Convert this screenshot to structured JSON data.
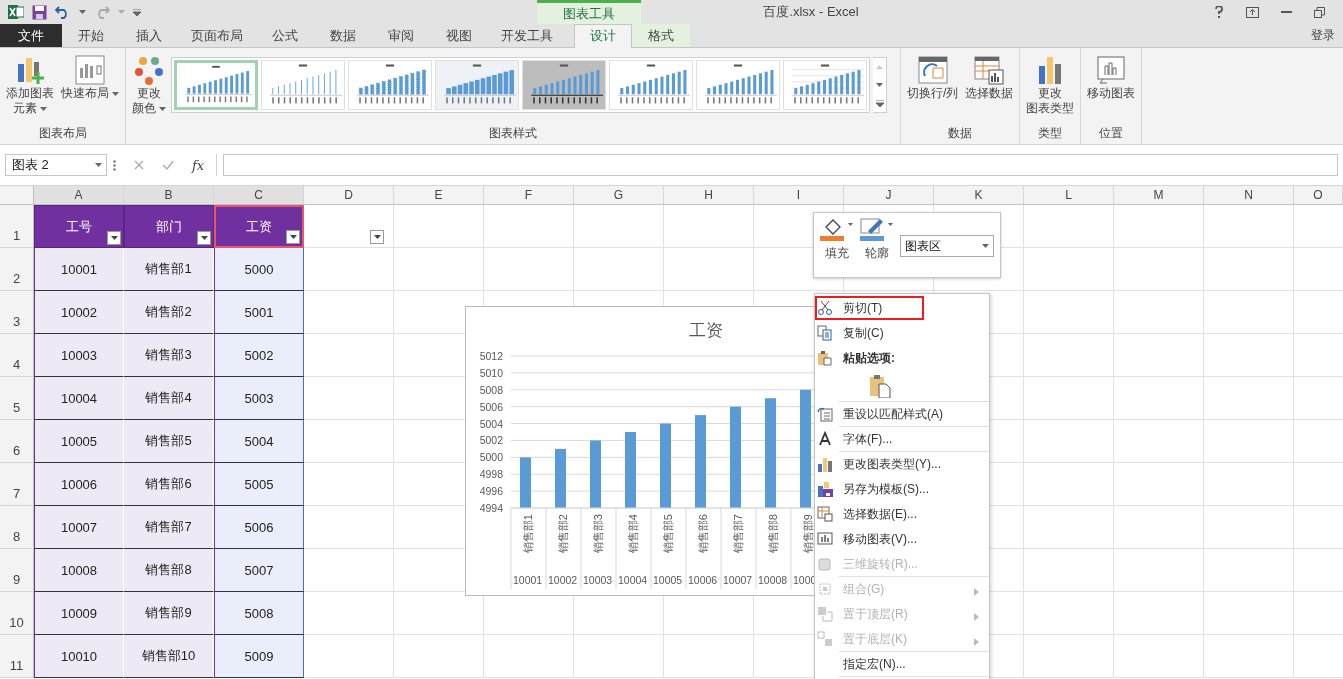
{
  "window": {
    "title": "百度.xlsx - Excel",
    "context_group": "图表工具",
    "sign_in": "登录"
  },
  "tabs": [
    {
      "label": "文件",
      "kind": "file",
      "selected": false
    },
    {
      "label": "开始",
      "kind": "normal",
      "selected": false
    },
    {
      "label": "插入",
      "kind": "normal",
      "selected": false
    },
    {
      "label": "页面布局",
      "kind": "normal",
      "selected": false
    },
    {
      "label": "公式",
      "kind": "normal",
      "selected": false
    },
    {
      "label": "数据",
      "kind": "normal",
      "selected": false
    },
    {
      "label": "审阅",
      "kind": "normal",
      "selected": false
    },
    {
      "label": "视图",
      "kind": "normal",
      "selected": false
    },
    {
      "label": "开发工具",
      "kind": "normal",
      "selected": false
    },
    {
      "label": "设计",
      "kind": "context",
      "selected": true
    },
    {
      "label": "格式",
      "kind": "context",
      "selected": false
    }
  ],
  "ribbon": {
    "groups": [
      {
        "title": "图表布局",
        "buttons": [
          {
            "lines": [
              "添加图表",
              "元素"
            ],
            "kind": "add-element",
            "dropdown": true
          },
          {
            "lines": [
              "快速布局"
            ],
            "kind": "quick-layout",
            "dropdown": true
          }
        ]
      },
      {
        "title": "图表样式",
        "buttons": [
          {
            "lines": [
              "更改",
              "颜色"
            ],
            "kind": "colors",
            "dropdown": true
          }
        ],
        "gallery": [
          {
            "kind": "plain",
            "selected": true
          },
          {
            "kind": "lines",
            "selected": false
          },
          {
            "kind": "dotted",
            "selected": false
          },
          {
            "kind": "gradient",
            "selected": false
          },
          {
            "kind": "dark",
            "selected": false
          },
          {
            "kind": "plain",
            "selected": false
          },
          {
            "kind": "plain",
            "selected": false
          },
          {
            "kind": "grid",
            "selected": false
          }
        ]
      },
      {
        "title": "数据",
        "buttons": [
          {
            "lines": [
              "切换行/列"
            ],
            "kind": "switch",
            "dropdown": false
          },
          {
            "lines": [
              "选择数据"
            ],
            "kind": "select-data",
            "dropdown": false
          }
        ]
      },
      {
        "title": "类型",
        "buttons": [
          {
            "lines": [
              "更改",
              "图表类型"
            ],
            "kind": "chart-type",
            "dropdown": false
          }
        ]
      },
      {
        "title": "位置",
        "buttons": [
          {
            "lines": [
              "移动图表"
            ],
            "kind": "move-chart",
            "dropdown": false
          }
        ]
      }
    ]
  },
  "formula_bar": {
    "name_box": "图表 2",
    "fx": "fx"
  },
  "sheet": {
    "columns": [
      "A",
      "B",
      "C",
      "D",
      "E",
      "F",
      "G",
      "H",
      "I",
      "J",
      "K",
      "L",
      "M",
      "N",
      "O"
    ],
    "row_numbers": [
      "1",
      "2",
      "3",
      "4",
      "5",
      "6",
      "7",
      "8",
      "9",
      "10",
      "11"
    ],
    "header": [
      {
        "text": "工号",
        "filter": true,
        "selected": false
      },
      {
        "text": "部门",
        "filter": true,
        "selected": false
      },
      {
        "text": "工资",
        "filter": true,
        "selected": true
      },
      {
        "filter": true,
        "selected": false
      }
    ],
    "rows": [
      [
        "10001",
        "销售部1",
        "5000"
      ],
      [
        "10002",
        "销售部2",
        "5001"
      ],
      [
        "10003",
        "销售部3",
        "5002"
      ],
      [
        "10004",
        "销售部4",
        "5003"
      ],
      [
        "10005",
        "销售部5",
        "5004"
      ],
      [
        "10006",
        "销售部6",
        "5005"
      ],
      [
        "10007",
        "销售部7",
        "5006"
      ],
      [
        "10008",
        "销售部8",
        "5007"
      ],
      [
        "10009",
        "销售部9",
        "5008"
      ],
      [
        "10010",
        "销售部10",
        "5009"
      ]
    ]
  },
  "chart": {
    "id_labels": [
      "10001",
      "10002",
      "10003",
      "10004",
      "10005",
      "10006",
      "10007",
      "10008",
      "1000"
    ],
    "chart_data": {
      "type": "bar",
      "title": "工资",
      "categories": [
        "销售部1",
        "销售部2",
        "销售部3",
        "销售部4",
        "销售部5",
        "销售部6",
        "销售部7",
        "销售部8",
        "销售部9"
      ],
      "series": [
        {
          "color": "#5b9bd5",
          "values": [
            5000,
            5001,
            5002,
            5003,
            5004,
            5005,
            5006,
            5007,
            5008
          ]
        }
      ],
      "grid": true,
      "ylim": [
        4994,
        5012
      ],
      "yticks": [
        4994,
        4996,
        4998,
        5000,
        5002,
        5004,
        5006,
        5008,
        5010,
        5012
      ]
    }
  },
  "mini_toolbar": {
    "fill": "填充",
    "outline": "轮廓",
    "element": "图表区"
  },
  "context_menu": [
    {
      "kind": "cut",
      "label": "剪切(T)",
      "disabled": false,
      "highlighted": true,
      "submenu": false,
      "divider_below": false
    },
    {
      "kind": "copy",
      "label": "复制(C)",
      "disabled": false,
      "highlighted": false,
      "submenu": false,
      "divider_below": false
    },
    {
      "kind": "paste-header",
      "label": "粘贴选项:",
      "disabled": false,
      "highlighted": false,
      "submenu": false,
      "divider_below": false
    },
    {
      "kind": "paste",
      "disabled": false,
      "highlighted": false,
      "submenu": false,
      "divider_below": true
    },
    {
      "kind": "reset",
      "label": "重设以匹配样式(A)",
      "disabled": false,
      "highlighted": false,
      "submenu": false,
      "divider_below": true
    },
    {
      "kind": "font",
      "label": "字体(F)...",
      "disabled": false,
      "highlighted": false,
      "submenu": false,
      "divider_below": true
    },
    {
      "kind": "chart-type",
      "label": "更改图表类型(Y)...",
      "disabled": false,
      "highlighted": false,
      "submenu": false,
      "divider_below": false
    },
    {
      "kind": "template",
      "label": "另存为模板(S)...",
      "disabled": false,
      "highlighted": false,
      "submenu": false,
      "divider_below": false
    },
    {
      "kind": "select-data",
      "label": "选择数据(E)...",
      "disabled": false,
      "highlighted": false,
      "submenu": false,
      "divider_below": false
    },
    {
      "kind": "move-chart",
      "label": "移动图表(V)...",
      "disabled": false,
      "highlighted": false,
      "submenu": false,
      "divider_below": false
    },
    {
      "kind": "rotate",
      "label": "三维旋转(R)...",
      "disabled": true,
      "highlighted": false,
      "submenu": false,
      "divider_below": true
    },
    {
      "kind": "group",
      "label": "组合(G)",
      "disabled": true,
      "highlighted": false,
      "submenu": true,
      "divider_below": false
    },
    {
      "kind": "front",
      "label": "置于顶层(R)",
      "disabled": true,
      "highlighted": false,
      "submenu": true,
      "divider_below": false
    },
    {
      "kind": "back",
      "label": "置于底层(K)",
      "disabled": true,
      "highlighted": false,
      "submenu": true,
      "divider_below": true
    },
    {
      "kind": "macro",
      "label": "指定宏(N)...",
      "disabled": false,
      "highlighted": false,
      "submenu": false,
      "divider_below": true
    }
  ]
}
